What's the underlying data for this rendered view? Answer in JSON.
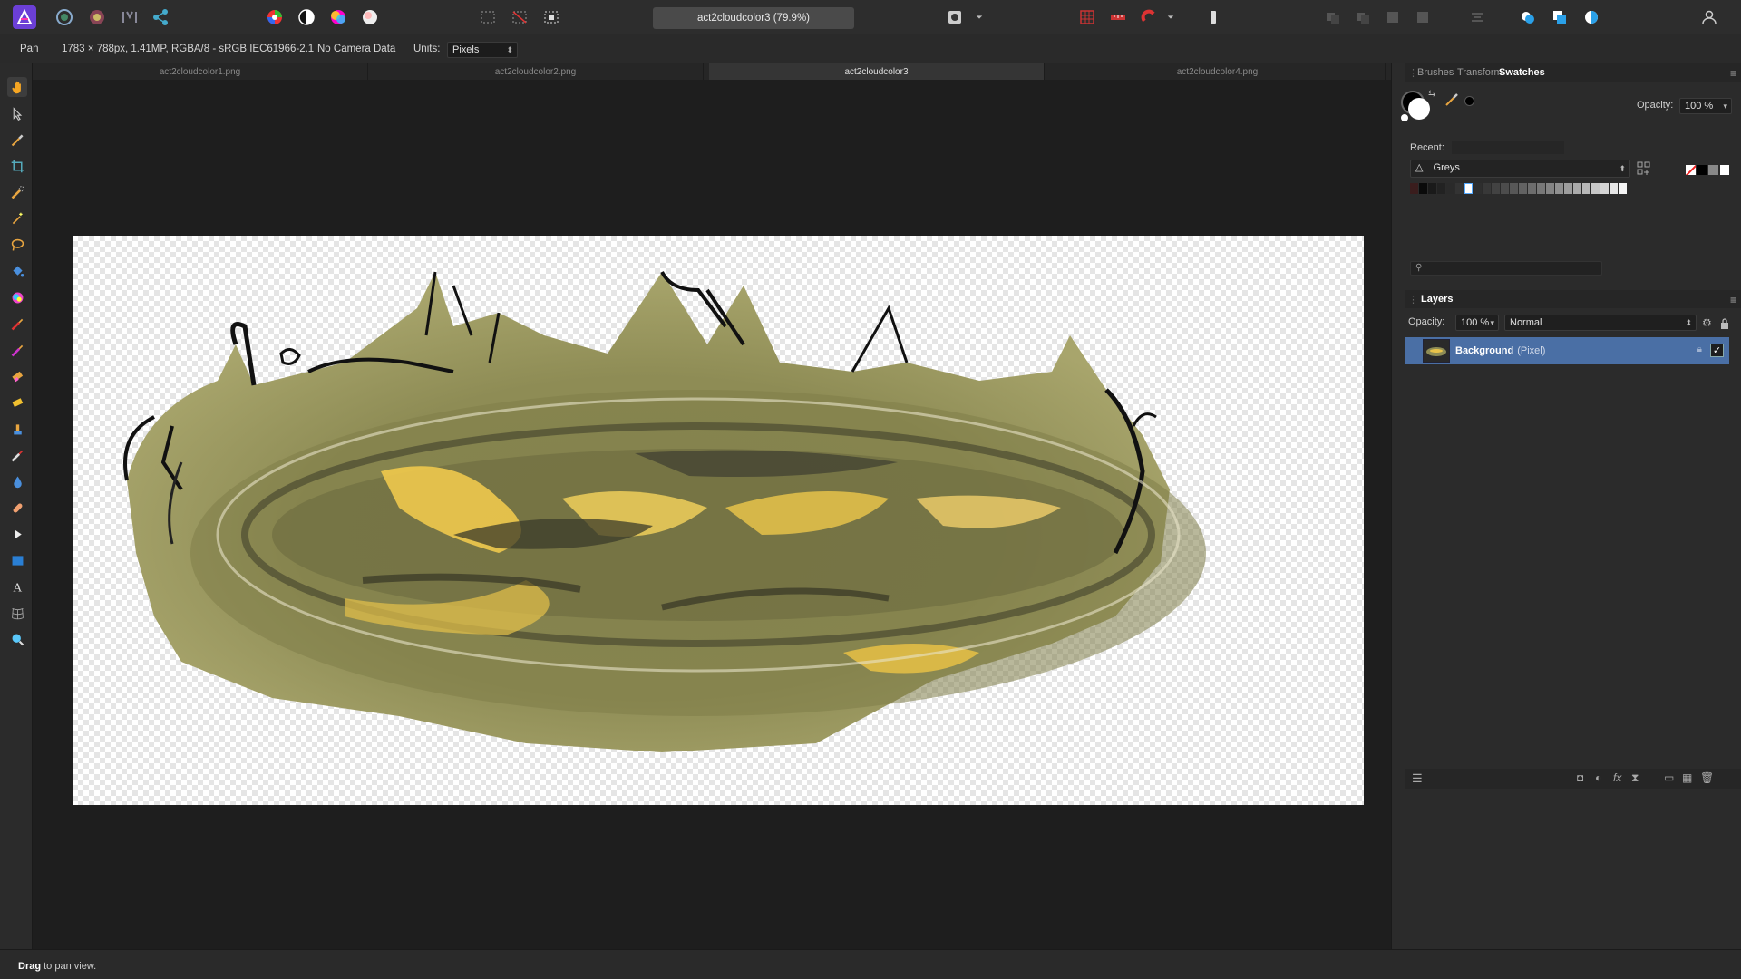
{
  "toolbar": {
    "document_title": "act2cloudcolor3 (79.9%)"
  },
  "context": {
    "tool_name": "Pan",
    "doc_info": "1783 × 788px, 1.41MP, RGBA/8 - sRGB IEC61966-2.1",
    "camera": "No Camera Data",
    "units_label": "Units:",
    "units_value": "Pixels"
  },
  "tabs": [
    {
      "label": "act2cloudcolor1.png",
      "active": false
    },
    {
      "label": "act2cloudcolor2.png",
      "active": false
    },
    {
      "label": "act2cloudcolor3",
      "active": true
    },
    {
      "label": "act2cloudcolor4.png",
      "active": false
    }
  ],
  "tools": [
    "pan-icon",
    "move-icon",
    "color-picker-icon",
    "crop-icon",
    "selection-brush-icon",
    "magic-wand-icon",
    "freehand-selection-icon",
    "flood-fill-icon",
    "gradient-icon",
    "paint-brush-icon",
    "color-replacement-icon",
    "erase-icon",
    "background-erase-icon",
    "clone-icon",
    "smudge-icon",
    "blur-icon",
    "healing-icon",
    "node-icon",
    "rectangle-icon",
    "text-icon",
    "mesh-warp-icon",
    "zoom-icon"
  ],
  "swatches_panel": {
    "tabs": [
      "Brushes",
      "Transform",
      "Swatches"
    ],
    "active_tab": "Swatches",
    "opacity_label": "Opacity:",
    "opacity_value": "100 %",
    "recent_label": "Recent:",
    "palette_name": "Greys",
    "search_placeholder": ""
  },
  "layers_panel": {
    "title": "Layers",
    "opacity_label": "Opacity:",
    "opacity_value": "100 %",
    "blend_mode": "Normal",
    "layer_name": "Background",
    "layer_type": "(Pixel)",
    "visible_check": "✓"
  },
  "status": {
    "bold": "Drag",
    "text": " to pan view."
  },
  "colors": {
    "accent_selection": "#4a6fa5",
    "app_bg": "#1e1e1e",
    "panel_bg": "#2b2b2b"
  }
}
